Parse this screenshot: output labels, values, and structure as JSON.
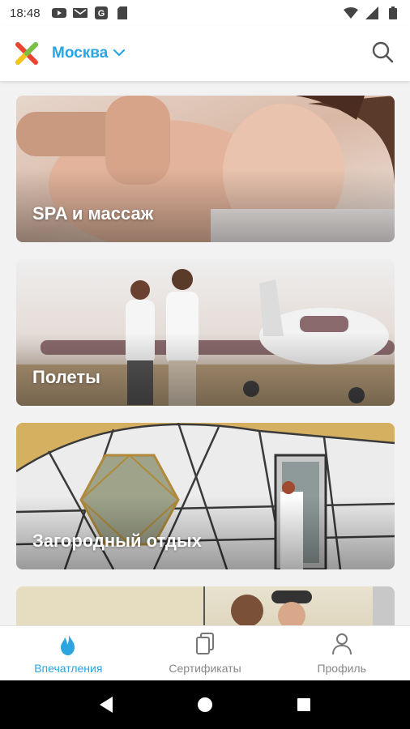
{
  "status_bar": {
    "time": "18:48",
    "left_icons": [
      "youtube-icon",
      "gmail-icon",
      "app-icon",
      "sd-card-icon"
    ],
    "right_icons": [
      "wifi-icon",
      "signal-icon",
      "battery-icon"
    ]
  },
  "app_bar": {
    "logo": "impression-logo",
    "city": "Москва",
    "search_icon": "search-icon"
  },
  "categories": [
    {
      "label": "SPA и массаж"
    },
    {
      "label": "Полеты"
    },
    {
      "label": "Загородный отдых"
    },
    {
      "label": ""
    }
  ],
  "bottom_nav": {
    "items": [
      {
        "label": "Впечатления",
        "icon": "flame-icon",
        "active": true
      },
      {
        "label": "Сертификаты",
        "icon": "certificates-icon",
        "active": false
      },
      {
        "label": "Профиль",
        "icon": "profile-icon",
        "active": false
      }
    ]
  },
  "system_nav": [
    "back-icon",
    "home-icon",
    "recents-icon"
  ],
  "colors": {
    "accent": "#29a6e0",
    "inactive": "#888888"
  }
}
